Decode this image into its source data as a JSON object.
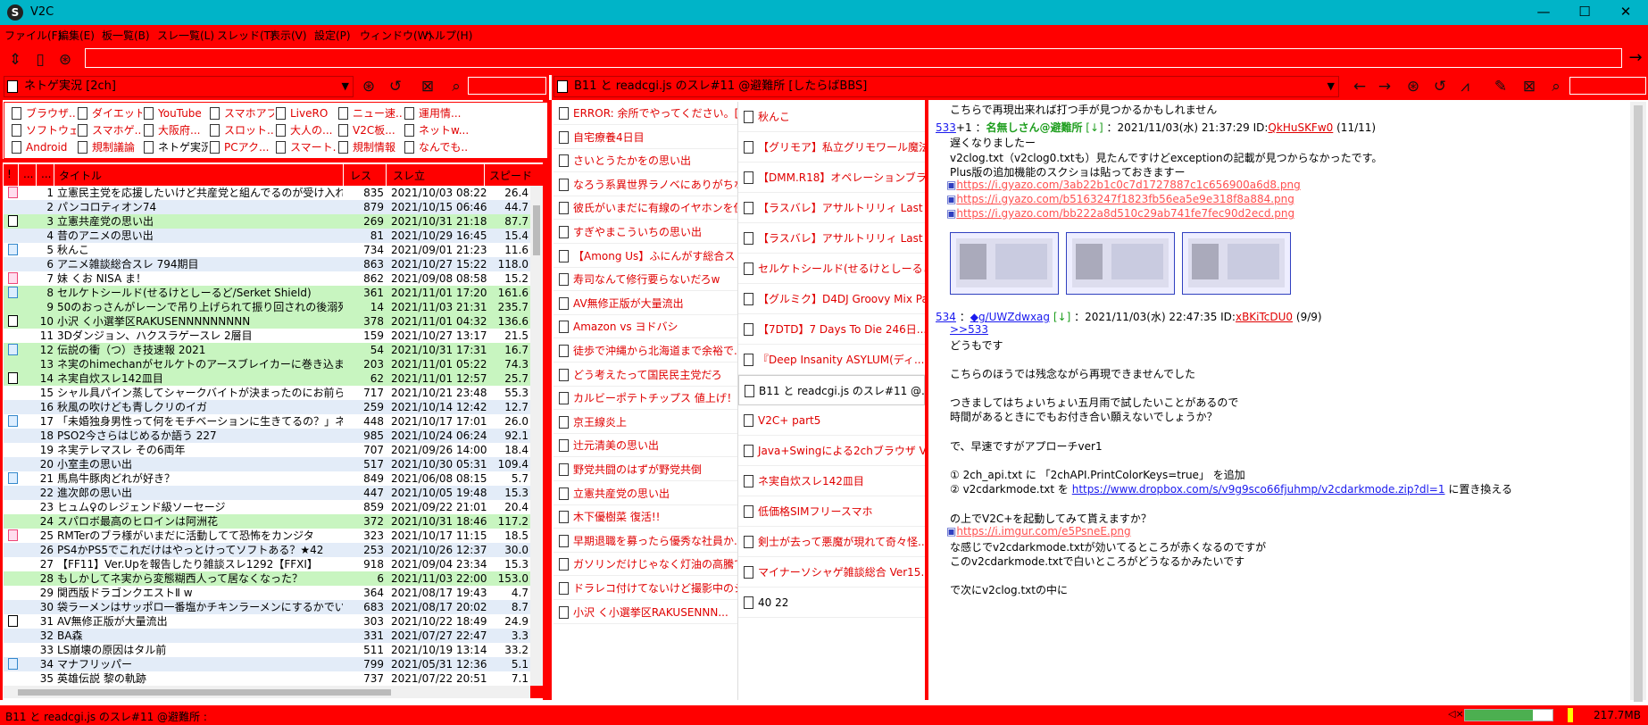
{
  "window": {
    "title": "V2C",
    "logo": "S",
    "min": "—",
    "max": "☐",
    "close": "✕"
  },
  "menu": [
    "ファイル(F)",
    "編集(E)",
    "板一覧(B)",
    "スレ一覧(L)",
    "スレッド(T)",
    "表示(V)",
    "設定(P)",
    "ウィンドウ(W)",
    "ヘルプ(H)"
  ],
  "toolbar": {
    "address_value": "",
    "go_icon": "→"
  },
  "board_panel": {
    "selected_board": "ネトゲ実況 [2ch]",
    "search_value": "",
    "tabs": [
      {
        "label": "ブラウザ..."
      },
      {
        "label": "ダイエット"
      },
      {
        "label": "YouTube"
      },
      {
        "label": "スマホアプリ"
      },
      {
        "label": "LiveRO"
      },
      {
        "label": "ニュー速..."
      },
      {
        "label": "運用情..."
      },
      {
        "label": "ソフトウェア"
      },
      {
        "label": "スマホゲ..."
      },
      {
        "label": "大阪府..."
      },
      {
        "label": "スロット..."
      },
      {
        "label": "大人の..."
      },
      {
        "label": "V2C板..."
      },
      {
        "label": "ネットw..."
      },
      {
        "label": "Android"
      },
      {
        "label": "規制議論"
      },
      {
        "label": "ネトゲ実況",
        "active": true
      },
      {
        "label": "PCアク..."
      },
      {
        "label": "スマート..."
      },
      {
        "label": "規制情報"
      },
      {
        "label": "なんでも..."
      }
    ],
    "columns": {
      "mark": "!",
      "c2": "...",
      "c3": "...",
      "title": "タイトル",
      "res": "レス",
      "date": "スレ立",
      "speed": "スピード"
    },
    "rows": [
      {
        "no": "1",
        "title": "立憲民主党を応援したいけど共産党と組んでるのが受け入れら...",
        "res": "835",
        "date": "2021/10/03 08:22",
        "speed": "26.4",
        "bg": "w",
        "icon": "pink"
      },
      {
        "no": "2",
        "title": "パンコロティオン74",
        "res": "879",
        "date": "2021/10/15 06:46",
        "speed": "44.7",
        "bg": "b",
        "icon": ""
      },
      {
        "no": "3",
        "title": "立憲共産党の思い出",
        "res": "269",
        "date": "2021/10/31 21:18",
        "speed": "87.7",
        "bg": "g",
        "icon": "dark"
      },
      {
        "no": "4",
        "title": "昔のアニメの思い出",
        "res": "81",
        "date": "2021/10/29 16:45",
        "speed": "15.4",
        "bg": "b",
        "icon": ""
      },
      {
        "no": "5",
        "title": "秋んこ",
        "res": "734",
        "date": "2021/09/01 21:23",
        "speed": "11.6",
        "bg": "w",
        "icon": "blue"
      },
      {
        "no": "6",
        "title": "アニメ雑談総合スレ 794期目",
        "res": "863",
        "date": "2021/10/27 15:22",
        "speed": "118.0",
        "bg": "b",
        "icon": ""
      },
      {
        "no": "7",
        "title": "妹 くお NISA ま！",
        "res": "862",
        "date": "2021/09/08 08:58",
        "speed": "15.2",
        "bg": "w",
        "icon": "pink"
      },
      {
        "no": "8",
        "title": "セルケトシールド(せるけとしーるど/Serket Shield)",
        "res": "361",
        "date": "2021/11/01 17:20",
        "speed": "161.6",
        "bg": "g",
        "icon": "blue"
      },
      {
        "no": "9",
        "title": "50のおっさんがレーンで吊り上げられて振り回されの後溺死...",
        "res": "14",
        "date": "2021/11/03 21:31",
        "speed": "235.7",
        "bg": "g",
        "icon": ""
      },
      {
        "no": "10",
        "title": "小沢 く小選挙区RAKUSENNNNNNNNN",
        "res": "378",
        "date": "2021/11/01 04:32",
        "speed": "136.6",
        "bg": "g",
        "icon": "dark"
      },
      {
        "no": "11",
        "title": "3Dダンジョン、ハクスラゲースレ 2層目",
        "res": "159",
        "date": "2021/10/27 13:17",
        "speed": "21.5",
        "bg": "w",
        "icon": ""
      },
      {
        "no": "12",
        "title": "伝説の衝（つ）き技速報 2021",
        "res": "54",
        "date": "2021/10/31 17:31",
        "speed": "16.7",
        "bg": "g",
        "icon": "blue"
      },
      {
        "no": "13",
        "title": "ネ実のhimechanがセルケトのアースブレイカーに巻き込まれてP...",
        "res": "203",
        "date": "2021/11/01 05:22",
        "speed": "74.3",
        "bg": "g",
        "icon": ""
      },
      {
        "no": "14",
        "title": "ネ実自炊スレ142皿目",
        "res": "62",
        "date": "2021/11/01 12:57",
        "speed": "25.7",
        "bg": "g",
        "icon": "dark"
      },
      {
        "no": "15",
        "title": "シャル具パイン蒸してシャークバイトが決まったのにお前らはFFか",
        "res": "717",
        "date": "2021/10/21 23:48",
        "speed": "55.3",
        "bg": "w",
        "icon": ""
      },
      {
        "no": "16",
        "title": "秋風の吹けども青しクリのイガ",
        "res": "259",
        "date": "2021/10/14 12:42",
        "speed": "12.7",
        "bg": "b",
        "icon": ""
      },
      {
        "no": "17",
        "title": "「未婚独身男性って何をモチベーションに生きてるの？」ネットで...",
        "res": "448",
        "date": "2021/10/17 17:01",
        "speed": "26.0",
        "bg": "w",
        "icon": "blue"
      },
      {
        "no": "18",
        "title": "PSO2今さらはじめるか語う 227",
        "res": "985",
        "date": "2021/10/24 06:24",
        "speed": "92.1",
        "bg": "b",
        "icon": ""
      },
      {
        "no": "19",
        "title": "ネ実テレマスレ その6両年",
        "res": "707",
        "date": "2021/09/26 14:00",
        "speed": "18.4",
        "bg": "w",
        "icon": ""
      },
      {
        "no": "20",
        "title": "小室圭の思い出",
        "res": "517",
        "date": "2021/10/30 05:31",
        "speed": "109.4",
        "bg": "b",
        "icon": ""
      },
      {
        "no": "21",
        "title": "馬鳥牛豚肉どれが好き？",
        "res": "849",
        "date": "2021/06/08 08:15",
        "speed": "5.7",
        "bg": "w",
        "icon": "blue"
      },
      {
        "no": "22",
        "title": "進次郎の思い出",
        "res": "447",
        "date": "2021/10/05 19:48",
        "speed": "15.3",
        "bg": "b",
        "icon": ""
      },
      {
        "no": "23",
        "title": "ヒュム♀のレジェンド級ソーセージ",
        "res": "859",
        "date": "2021/09/22 21:01",
        "speed": "20.4",
        "bg": "w",
        "icon": ""
      },
      {
        "no": "24",
        "title": "スパロボ最高のヒロインは阿洲花",
        "res": "372",
        "date": "2021/10/31 18:46",
        "speed": "117.2",
        "bg": "g",
        "icon": ""
      },
      {
        "no": "25",
        "title": "RMTerのブラ様がいまだに活動してて恐怖をカンジタ",
        "res": "323",
        "date": "2021/10/17 11:15",
        "speed": "18.5",
        "bg": "w",
        "icon": "pink"
      },
      {
        "no": "26",
        "title": "PS4かPS5でこれだけはやっとけってソフトある？★42",
        "res": "253",
        "date": "2021/10/26 12:37",
        "speed": "30.0",
        "bg": "b",
        "icon": ""
      },
      {
        "no": "27",
        "title": "【FF11】Ver.Upを報告したり雑談スレ1292【FFXI】",
        "res": "918",
        "date": "2021/09/04 23:34",
        "speed": "15.3",
        "bg": "w",
        "icon": ""
      },
      {
        "no": "28",
        "title": "もしかしてネ実から変態糊西人って居なくなった？",
        "res": "6",
        "date": "2021/11/03 22:00",
        "speed": "153.0",
        "bg": "g",
        "icon": ""
      },
      {
        "no": "29",
        "title": "関西版ドラゴンクエストⅡ w",
        "res": "364",
        "date": "2021/08/17 19:43",
        "speed": "4.7",
        "bg": "w",
        "icon": ""
      },
      {
        "no": "30",
        "title": "袋ラーメンはサッポロ一番塩かチキンラーメンにするかでいつも迷う",
        "res": "683",
        "date": "2021/08/17 20:02",
        "speed": "8.7",
        "bg": "b",
        "icon": ""
      },
      {
        "no": "31",
        "title": "AV無修正版が大量流出",
        "res": "303",
        "date": "2021/10/22 18:49",
        "speed": "24.9",
        "bg": "w",
        "icon": "dark"
      },
      {
        "no": "32",
        "title": "BA森",
        "res": "331",
        "date": "2021/07/27 22:47",
        "speed": "3.3",
        "bg": "b",
        "icon": ""
      },
      {
        "no": "33",
        "title": "LS崩壊の原因はタル前",
        "res": "511",
        "date": "2021/10/19 13:14",
        "speed": "33.2",
        "bg": "w",
        "icon": ""
      },
      {
        "no": "34",
        "title": "マナフリッパー",
        "res": "799",
        "date": "2021/05/31 12:36",
        "speed": "5.1",
        "bg": "b",
        "icon": "blue"
      },
      {
        "no": "35",
        "title": "英雄伝説 黎の軌跡",
        "res": "737",
        "date": "2021/07/22 20:51",
        "speed": "7.1",
        "bg": "w",
        "icon": ""
      }
    ]
  },
  "thread_panel": {
    "selected_thread": "B11 と readcgi.js のスレ#11 @避難所 [したらばBBS]",
    "search_value": "",
    "list1": [
      "ERROR: 余所でやってください。[o...",
      "自宅療養4日目",
      "さいとうたかをの思い出",
      "なろう系異世界ラノベにありがちなこと",
      "彼氏がいまだに有線のイヤホンを使...",
      "すぎやまこういちの思い出",
      "【Among Us】ふにんがす総合スレ...",
      "寿司なんて修行要らないだろw",
      "AV無修正版が大量流出",
      "Amazon vs ヨドバシ",
      "徒歩で沖縄から北海道まで余裕で...",
      "どう考えたって国民民主党だろ",
      "カルビーポテトチップス 値上げ！！",
      "京王線炎上",
      "辻元清美の思い出",
      "野党共闘のはずが野党共倒",
      "立憲共産党の思い出",
      "木下優樹菜 復活!!",
      "早期退職を募ったら優秀な社員か...",
      "ガソリンだけじゃなく灯油の高騰で...",
      "ドラレコ付けてないけど撮影中のシ...",
      "小沢 く小選挙区RAKUSENNN..."
    ],
    "list2": [
      "秋んこ",
      "【グリモア】私立グリモワール魔法学...",
      "【DMM.R18】オペレーションブラック...",
      "【ラスバレ】アサルトリリィ Last Bull...",
      "【ラスバレ】アサルトリリィ Last Bull...",
      "セルケトシールド(せるけとしーるど/S...",
      "【グルミク】D4DJ Groovy Mix Pa...",
      "【7DTD】7 Days To Die 246日...",
      "『Deep Insanity ASYLUM(ディ...",
      "B11 と readcgi.js のスレ#11 @...",
      "V2C+ part5",
      "Java+Swingによる2chブラウザ V...",
      "ネ実自炊スレ142皿目",
      "低価格SIMフリースマホ",
      "剣士が去って悪魔が現れて奇々怪...",
      "マイナーソシャゲ雑談総合 Ver15....",
      "40 22"
    ],
    "post_top_line": "こちらで再現出来れば打つ手が見つかるかもしれません",
    "post533": {
      "num": "533",
      "plus": "+1",
      "sep": "：",
      "name": "名無しさん@避難所",
      "arrow": "[↓]",
      "date": "：2021/11/03(水) 21:37:29 ID:",
      "id": "QkHuSKFw0",
      "count": "(11/11)",
      "lines": [
        "遅くなりましたー",
        "v2clog.txt（v2clog0.txtも）見たんですけどexceptionの記載が見つからなかったです。",
        "Plus版の追加機能のスクショは貼っておきますー"
      ],
      "links": [
        "https://i.gyazo.com/3ab22b1c0c7d1727887c1c656900a6d8.png",
        "https://i.gyazo.com/b5163247f1823fb56ea5e9e318f8a884.png",
        "https://i.gyazo.com/bb222a8d510c29ab741fe7fec90d2ecd.png"
      ]
    },
    "post534": {
      "num": "534",
      "sep": "：",
      "name": "◆g/UWZdwxag",
      "arrow": "[↓]",
      "date": "：2021/11/03(水) 22:47:35 ID:",
      "id": "xBKiTcDU0",
      "count": "(9/9)",
      "anchor": ">>533",
      "l1": "どうもです",
      "l2": "こちらのほうでは残念ながら再現できませんでした",
      "l3": "つきましてはちょいちょい五月雨で試したいことがあるので",
      "l4": "時間があるときにでもお付き合い願えないでしょうか？",
      "l5": "で、早速ですがアプローチver1",
      "l6": "① 2ch_api.txt に 「2chAPI.PrintColorKeys=true」 を追加",
      "l7a": "② v2cdarkmode.txt を ",
      "l7link": "https://www.dropbox.com/s/v9g9sco66fjuhmp/v2cdarkmode.zip?dl=1",
      "l7b": " に置き換える",
      "l8": "の上でV2C+を起動してみて貰えますか？",
      "l9link": "https://i.imgur.com/e5PsneE.png",
      "l10": "な感じでv2cdarkmode.txtが効いてるところが赤くなるのですが",
      "l11": "このv2cdarkmode.txtで白いところがどうなるかみたいです",
      "l12": "で次にv2clog.txtの中に"
    }
  },
  "status": {
    "text": "B11 と readcgi.js のスレ#11 @避難所 :",
    "memory": "217.7MB",
    "progress": 0.78
  },
  "colors": {
    "titlebar": "#00b4c8",
    "chrome": "#ff0000",
    "unread_title": "#e00000",
    "green_row": "#c8f5c0",
    "blue_row": "#e3ecf8"
  }
}
